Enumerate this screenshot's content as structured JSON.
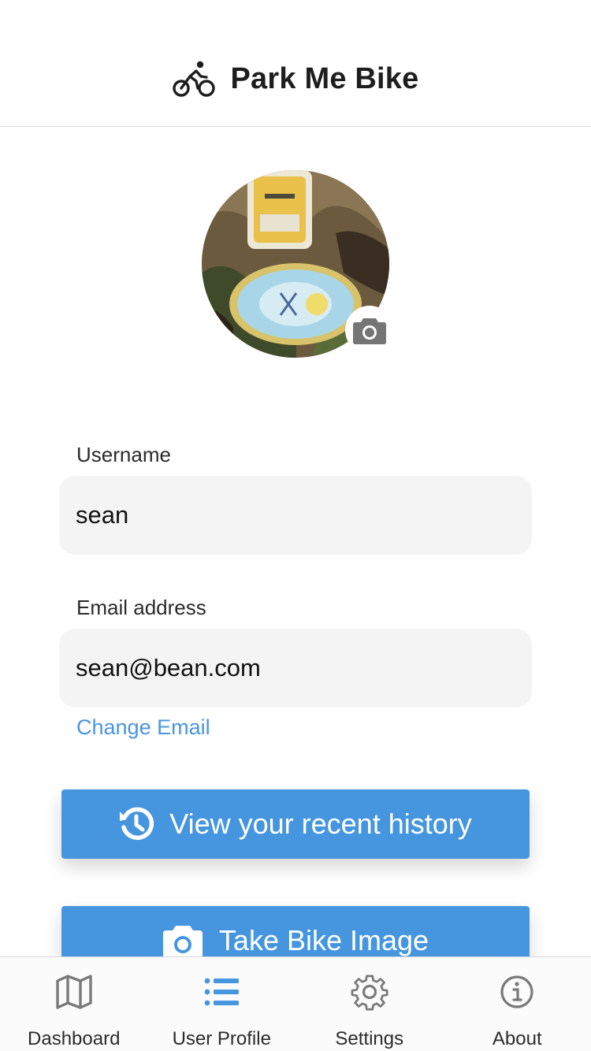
{
  "header": {
    "title": "Park Me Bike",
    "logo_icon": "bicycle-icon"
  },
  "profile": {
    "avatar_icon": "profile-photo",
    "camera_icon": "camera-icon"
  },
  "form": {
    "username_label": "Username",
    "username_value": "sean",
    "email_label": "Email address",
    "email_value": "sean@bean.com",
    "change_email_link": "Change Email"
  },
  "buttons": {
    "history": {
      "label": "View your recent history",
      "icon": "history-icon"
    },
    "take_image": {
      "label": "Take Bike Image",
      "icon": "camera-icon"
    }
  },
  "tabbar": {
    "items": [
      {
        "label": "Dashboard",
        "icon": "map-icon",
        "active": false
      },
      {
        "label": "User Profile",
        "icon": "list-icon",
        "active": true
      },
      {
        "label": "Settings",
        "icon": "gear-icon",
        "active": false
      },
      {
        "label": "About",
        "icon": "info-icon",
        "active": false
      }
    ]
  },
  "colors": {
    "accent": "#4596df",
    "link": "#4a94e0",
    "tab_inactive": "#777777"
  }
}
